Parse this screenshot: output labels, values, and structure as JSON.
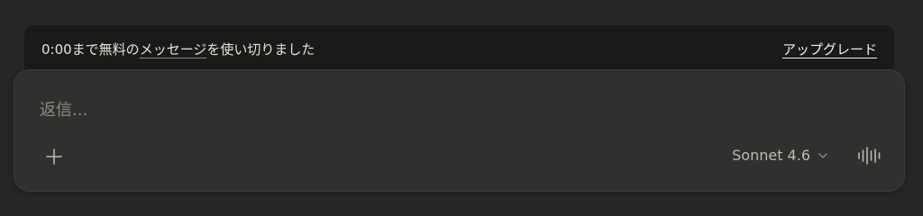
{
  "banner": {
    "message_prefix": "0:00まで無料の",
    "message_link": "メッセージ",
    "message_suffix": "を使い切りました",
    "upgrade_label": "アップグレード"
  },
  "composer": {
    "placeholder": "返信...",
    "value": "",
    "model_label": "Sonnet 4.6",
    "icons": {
      "add": "plus-icon",
      "model_dropdown": "chevron-down-icon",
      "voice": "voice-waveform-icon"
    }
  },
  "colors": {
    "background": "#262624",
    "banner_background": "#1a1a19",
    "composer_background": "#30302e",
    "text_primary": "#e4e2da",
    "text_muted": "#8f8d86"
  }
}
